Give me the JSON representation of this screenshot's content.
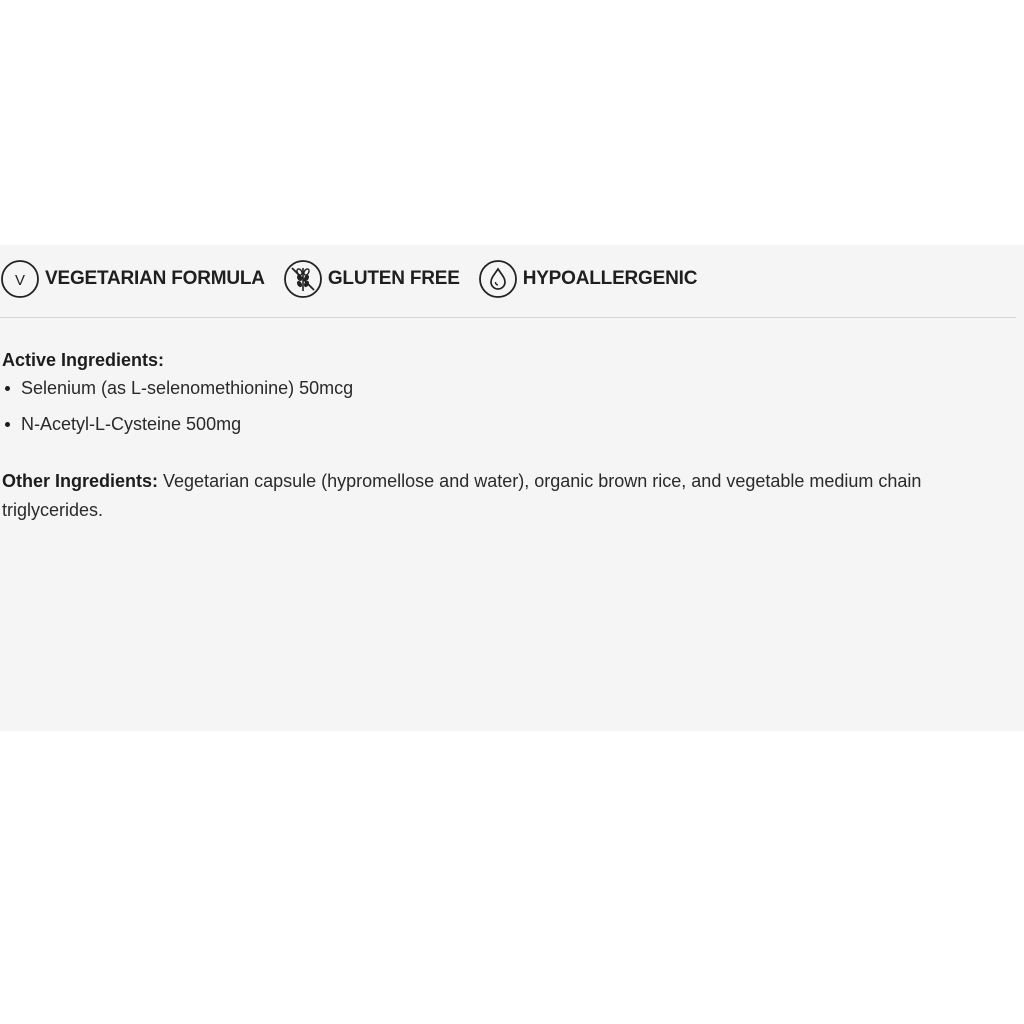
{
  "badges": [
    {
      "label": "VEGETARIAN FORMULA",
      "icon": "vegetarian-v-icon"
    },
    {
      "label": "GLUTEN FREE",
      "icon": "wheat-crossed-icon"
    },
    {
      "label": "HYPOALLERGENIC",
      "icon": "droplet-icon"
    }
  ],
  "active_ingredients": {
    "heading": "Active Ingredients:",
    "items": [
      "Selenium (as L-selenomethionine) 50mcg",
      "N-Acetyl-L-Cysteine 500mg"
    ]
  },
  "other_ingredients": {
    "heading": "Other Ingredients:",
    "text": " Vegetarian capsule (hypromellose and water), organic brown rice, and vegetable medium chain triglycerides."
  },
  "colors": {
    "panel_background": "#f4f5f4",
    "text": "#1d1d1d",
    "divider": "#d7d9d8"
  }
}
